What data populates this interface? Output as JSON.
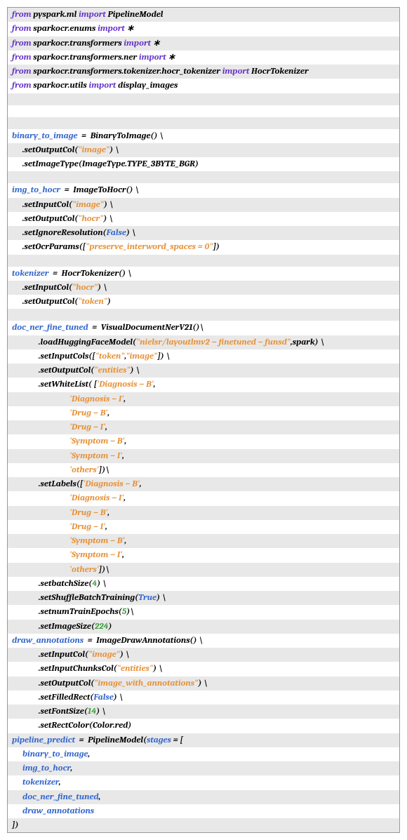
{
  "code": {
    "l1": {
      "kw": "from",
      "mod": "pyspark",
      "op": ".",
      "sub": "ml",
      "kw2": "import",
      "cls": "PipelineModel"
    },
    "l2": {
      "kw": "from",
      "mod": "sparkocr",
      "op": ".",
      "sub": "enums",
      "kw2": "import",
      "star": "∗"
    },
    "l3": {
      "kw": "from",
      "mod": "sparkocr",
      "op": ".",
      "sub": "transformers",
      "kw2": "import",
      "star": "∗"
    },
    "l4": {
      "kw": "from",
      "mod": "sparkocr",
      "op": ".",
      "sub1": "transformers",
      "sub2": "ner",
      "kw2": "import",
      "star": "∗"
    },
    "l5": {
      "kw": "from",
      "mod": "sparkocr",
      "op": ".",
      "path": "transformers.tokenizer.hocr_tokenizer",
      "kw2": "import",
      "cls": "HocrTokenizer"
    },
    "l6": {
      "kw": "from",
      "mod": "sparkocr",
      "op": ".",
      "sub": "utils",
      "kw2": "import",
      "fn": "display_images"
    },
    "bti": {
      "var": "binary_to_image",
      "eq": "=",
      "cls": "BinaryToImage",
      "call": "() \\"
    },
    "bti1": {
      "method": ".setOutputCol",
      "arg": "\"image\"",
      "close": ") \\"
    },
    "bti2": {
      "method": ".setImageType",
      "open": "(",
      "v1": "ImageType",
      "dot": ".",
      "v2": "TYPE_3BYTE_BGR",
      "close": ")"
    },
    "ith": {
      "var": "img_to_hocr",
      "eq": "=",
      "cls": "ImageToHocr",
      "call": "() \\"
    },
    "ith1": {
      "method": ".setInputCol",
      "arg": "\"image\"",
      "close": ") \\"
    },
    "ith2": {
      "method": ".setOutputCol",
      "arg": "\"hocr\"",
      "close": ") \\"
    },
    "ith3": {
      "method": ".setIgnoreResolution",
      "arg": "False",
      "close": ") \\"
    },
    "ith4": {
      "method": ".setOcrParams",
      "open": "([",
      "arg": "\"preserve_interword_spaces = 0\"",
      "close": "])"
    },
    "tok": {
      "var": "tokenizer",
      "eq": "=",
      "cls": "HocrTokenizer",
      "call": "() \\"
    },
    "tok1": {
      "method": ".setInputCol",
      "arg": "\"hocr\"",
      "close": ") \\"
    },
    "tok2": {
      "method": ".setOutputCol",
      "arg": "\"token\"",
      "close": ")"
    },
    "dnf": {
      "var": "doc_ner_fine_tuned",
      "eq": "=",
      "cls": "VisualDocumentNerV21",
      "call": "()\\"
    },
    "dnf1": {
      "method": ".loadHuggingFaceModel",
      "open": "(",
      "arg": "\"nielsr/layoutlmv2 − finetuned − funsd\"",
      "comma": ",",
      "arg2": "spark",
      "close": ") \\"
    },
    "dnf2": {
      "method": ".setInputCols",
      "open": "([",
      "a1": "\"token\"",
      "comma": ",",
      "a2": "\"image\"",
      "close": "]) \\"
    },
    "dnf3": {
      "method": ".setOutputCol",
      "arg": "\"entities\"",
      "close": ") \\"
    },
    "dnf4": {
      "method": ".setWhiteList",
      "open": "( [",
      "arg": "'Diagnosis − B'",
      "comma": ","
    },
    "wl1": "'Diagnosis − I'",
    "wl2": "'Drug − B'",
    "wl3": "'Drug − I'",
    "wl4": "'Symptom − B'",
    "wl5": "'Symptom − I'",
    "wl6": "'others'",
    "wlclose": "])\\",
    "dnf5": {
      "method": ".setLabels",
      "open": "([",
      "arg": "'Diagnosis − B'",
      "comma": ","
    },
    "lb1": "'Diagnosis − I'",
    "lb2": "'Drug − B'",
    "lb3": "'Drug − I'",
    "lb4": "'Symptom − B'",
    "lb5": "'Symptom − I'",
    "lb6": "'others'",
    "lbclose": "])\\",
    "bs": {
      "method": ".setbatchSize",
      "open": "(",
      "num": "4",
      "close": ") \\"
    },
    "sbt": {
      "method": ".setShuffleBatchTraining",
      "open": "(",
      "bool": "True",
      "close": ") \\"
    },
    "nte": {
      "method": ".setnumTrainEpochs",
      "open": "(",
      "num": "5",
      "close": ")\\"
    },
    "sis": {
      "method": ".setImageSize",
      "open": "(",
      "num": "224",
      "close": ")"
    },
    "da": {
      "var": "draw_annotations",
      "eq": "=",
      "cls": "ImageDrawAnnotations",
      "call": "() \\"
    },
    "da1": {
      "method": ".setInputCol",
      "arg": "\"image\"",
      "close": ") \\"
    },
    "da2": {
      "method": ".setInputChunksCol",
      "arg": "\"entities\"",
      "close": ") \\"
    },
    "da3": {
      "method": ".setOutputCol",
      "arg": "\"image_with_annotations\"",
      "close": ") \\"
    },
    "da4": {
      "method": ".setFilledRect",
      "open": "(",
      "bool": "False",
      "close": ") \\"
    },
    "da5": {
      "method": ".setFontSize",
      "open": "(",
      "num": "14",
      "close": ") \\"
    },
    "da6": {
      "method": ".setRectColor",
      "open": "(",
      "v1": "Color",
      "dot": ".",
      "v2": "red",
      "close": ")"
    },
    "pp": {
      "var": "pipeline_predict",
      "eq": "=",
      "cls": "PipelineModel",
      "open": "(",
      "kw": "stages",
      "eq2": "=",
      "br": "["
    },
    "pp1": "binary_to_image",
    "pp2": "img_to_hocr",
    "pp3": "tokenizer",
    "pp4": "doc_ner_fine_tuned",
    "pp5": "draw_annotations",
    "ppclose": "])"
  }
}
